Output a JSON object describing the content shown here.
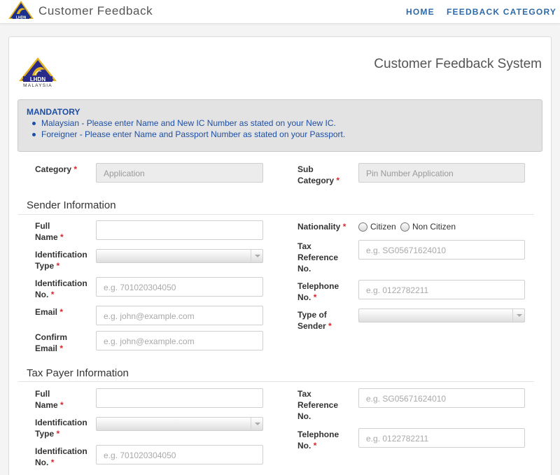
{
  "header": {
    "brand": "Customer Feedback",
    "logo_text": "LHDN",
    "nav": {
      "home": "HOME",
      "category": "FEEDBACK CATEGORY"
    }
  },
  "page": {
    "system_title": "Customer Feedback System",
    "logo": {
      "line1": "LHDN",
      "line2": "MALAYSIA"
    }
  },
  "mandatory": {
    "title": "MANDATORY",
    "items": [
      "Malaysian - Please enter Name and New IC Number as stated on your New IC.",
      "Foreigner - Please enter Name and Passport Number as stated on your Passport."
    ]
  },
  "required_mark": "*",
  "category": {
    "label": "Category",
    "value": "Application",
    "sub_label_line1": "Sub",
    "sub_label_line2": "Category",
    "sub_value": "Pin Number Application"
  },
  "sender": {
    "section_title": "Sender Information",
    "full_name": {
      "l1": "Full",
      "l2": "Name"
    },
    "id_type": {
      "l1": "Identification",
      "l2": "Type"
    },
    "id_no": {
      "l1": "Identification",
      "l2": "No.",
      "placeholder": "e.g. 701020304050"
    },
    "email": {
      "l1": "Email",
      "placeholder": "e.g. john@example.com"
    },
    "confirm_email": {
      "l1": "Confirm",
      "l2": "Email",
      "placeholder": "e.g. john@example.com"
    },
    "nationality": {
      "label": "Nationality",
      "options": [
        "Citizen",
        "Non Citizen"
      ]
    },
    "tax_ref": {
      "l1": "Tax",
      "l2": "Reference",
      "l3": "No.",
      "placeholder": "e.g. SG05671624010"
    },
    "telephone": {
      "l1": "Telephone",
      "l2": "No.",
      "placeholder": "e.g. 0122782211"
    },
    "sender_type": {
      "l1": "Type of",
      "l2": "Sender"
    }
  },
  "taxpayer": {
    "section_title": "Tax Payer Information",
    "full_name": {
      "l1": "Full",
      "l2": "Name"
    },
    "id_type": {
      "l1": "Identification",
      "l2": "Type"
    },
    "id_no": {
      "l1": "Identification",
      "l2": "No.",
      "placeholder": "e.g. 701020304050"
    },
    "tax_ref": {
      "l1": "Tax",
      "l2": "Reference",
      "l3": "No.",
      "placeholder": "e.g. SG05671624010"
    },
    "telephone": {
      "l1": "Telephone",
      "l2": "No.",
      "placeholder": "e.g. 0122782211"
    }
  },
  "colors": {
    "accent": "#2d6aa8",
    "mandatory_text": "#1f4fa3",
    "required": "#d9262c",
    "logo_blue": "#1b2f8f",
    "logo_gold": "#e3b21d"
  }
}
